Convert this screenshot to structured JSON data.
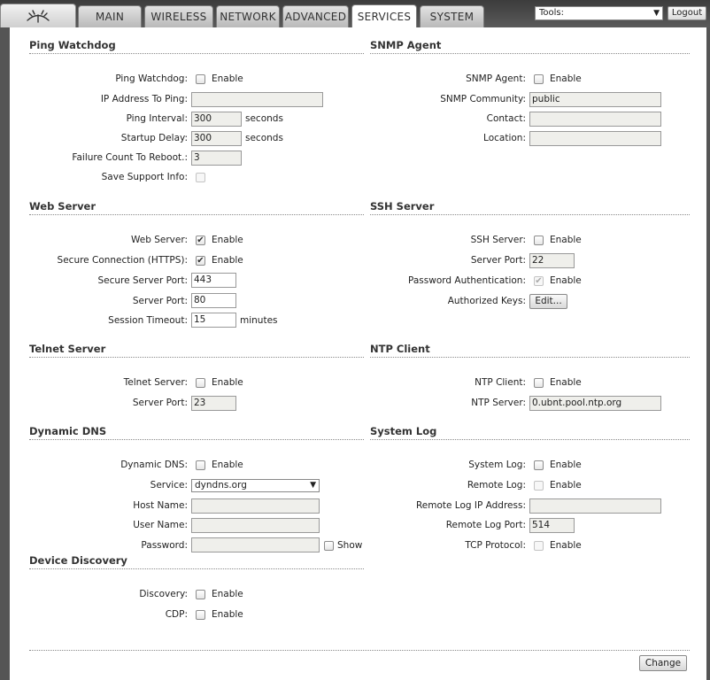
{
  "tabs": [
    "MAIN",
    "WIRELESS",
    "NETWORK",
    "ADVANCED",
    "SERVICES",
    "SYSTEM"
  ],
  "active_tab": "SERVICES",
  "tools": {
    "selected": "Tools:",
    "logout": "Logout"
  },
  "enable": "Enable",
  "ping": {
    "title": "Ping Watchdog",
    "watchdog_label": "Ping Watchdog:",
    "watchdog_enabled": false,
    "ip_label": "IP Address To Ping:",
    "ip_value": "",
    "interval_label": "Ping Interval:",
    "interval_value": "300",
    "interval_unit": "seconds",
    "startup_label": "Startup Delay:",
    "startup_value": "300",
    "startup_unit": "seconds",
    "failure_label": "Failure Count To Reboot.:",
    "failure_value": "3",
    "support_label": "Save Support Info:",
    "support_checked": false
  },
  "snmp": {
    "title": "SNMP Agent",
    "agent_label": "SNMP Agent:",
    "agent_enabled": false,
    "community_label": "SNMP Community:",
    "community_value": "public",
    "contact_label": "Contact:",
    "contact_value": "",
    "location_label": "Location:",
    "location_value": ""
  },
  "web": {
    "title": "Web Server",
    "server_label": "Web Server:",
    "server_enabled": true,
    "https_label": "Secure Connection (HTTPS):",
    "https_enabled": true,
    "secure_port_label": "Secure Server Port:",
    "secure_port_value": "443",
    "port_label": "Server Port:",
    "port_value": "80",
    "timeout_label": "Session Timeout:",
    "timeout_value": "15",
    "timeout_unit": "minutes"
  },
  "ssh": {
    "title": "SSH Server",
    "server_label": "SSH Server:",
    "server_enabled": false,
    "port_label": "Server Port:",
    "port_value": "22",
    "password_label": "Password Authentication:",
    "password_enabled": true,
    "keys_label": "Authorized Keys:",
    "keys_button": "Edit..."
  },
  "telnet": {
    "title": "Telnet Server",
    "server_label": "Telnet Server:",
    "server_enabled": false,
    "port_label": "Server Port:",
    "port_value": "23"
  },
  "ntp": {
    "title": "NTP Client",
    "client_label": "NTP Client:",
    "client_enabled": false,
    "server_label": "NTP Server:",
    "server_value": "0.ubnt.pool.ntp.org"
  },
  "ddns": {
    "title": "Dynamic DNS",
    "ddns_label": "Dynamic DNS:",
    "ddns_enabled": false,
    "service_label": "Service:",
    "service_value": "dyndns.org",
    "host_label": "Host Name:",
    "host_value": "",
    "user_label": "User Name:",
    "user_value": "",
    "password_label": "Password:",
    "password_value": "",
    "show_label": "Show"
  },
  "syslog": {
    "title": "System Log",
    "log_label": "System Log:",
    "log_enabled": false,
    "remote_label": "Remote Log:",
    "remote_enabled": false,
    "remote_ip_label": "Remote Log IP Address:",
    "remote_ip_value": "",
    "remote_port_label": "Remote Log Port:",
    "remote_port_value": "514",
    "tcp_label": "TCP Protocol:",
    "tcp_enabled": false
  },
  "discovery": {
    "title": "Device Discovery",
    "discovery_label": "Discovery:",
    "discovery_enabled": false,
    "cdp_label": "CDP:",
    "cdp_enabled": false
  },
  "change_button": "Change"
}
